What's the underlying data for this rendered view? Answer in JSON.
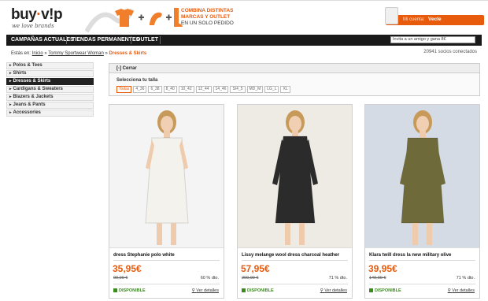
{
  "header": {
    "logo_a": "buy",
    "logo_dot": "·",
    "logo_b": "v!p",
    "tagline": "we love brands",
    "promo_lines": [
      "Combina distintas",
      "marcas y outlet",
      "en un solo pedido"
    ],
    "account_key": "Mi cuenta:",
    "account_name": "Vecle"
  },
  "nav": {
    "tabs": [
      "Campañas actuales",
      "Tiendas permanentes",
      "Outlet"
    ],
    "search_placeholder": "Invita a un amigo y gana 8€"
  },
  "breadcrumb": {
    "prefix": "Estás en:",
    "items": [
      "Inicio",
      "Tommy Sportwear Woman"
    ],
    "sep": "»",
    "current": "Dresses & Skirts"
  },
  "members": "20941 socios conectados",
  "sidebar": {
    "items": [
      "Polos & Tees",
      "Shirts",
      "Dresses & Skirts",
      "Cardigans & Sweaters",
      "Blazers & Jackets",
      "Jeans & Pants",
      "Accessories"
    ],
    "active_index": 2
  },
  "size_filter": {
    "toggle": "[-] Cerrar",
    "title": "Selecciona tu talla",
    "options": [
      "Todas",
      "4_36",
      "6_38",
      "8_40",
      "10_42",
      "12_44",
      "14_46",
      "S/4_5",
      "MD_M",
      "LG_L",
      "XL"
    ],
    "selected": "Todas"
  },
  "products": [
    {
      "name": "dress Stephanie polo white",
      "price": "35,95€",
      "old": "90,00 €",
      "discount": "60 % dto.",
      "status": "DISPONIBLE",
      "details": "Ver detalles",
      "dress_color": "#f4f2ec",
      "bg": "#f4f4f4"
    },
    {
      "name": "Lissy melange wool dress charcoal heather",
      "price": "57,95€",
      "old": "200,00 €",
      "discount": "71 % dto.",
      "status": "DISPONIBLE",
      "details": "Ver detalles",
      "dress_color": "#2b2b2b",
      "bg": "#eeeae4"
    },
    {
      "name": "Klara twill dress la new military olive",
      "price": "39,95€",
      "old": "140,00 €",
      "discount": "71 % dto.",
      "status": "DISPONIBLE",
      "details": "Ver detalles",
      "dress_color": "#6e6a3a",
      "bg": "#d4dbe4"
    }
  ],
  "colors": {
    "accent": "#e85a0c",
    "nav_bg": "#1a1a1a",
    "available": "#3a8a1e"
  },
  "icons": [
    "shopping-bag-icon",
    "tshirt-icon",
    "plus-icon",
    "boot-icon",
    "magnifier-icon",
    "available-square-icon"
  ]
}
